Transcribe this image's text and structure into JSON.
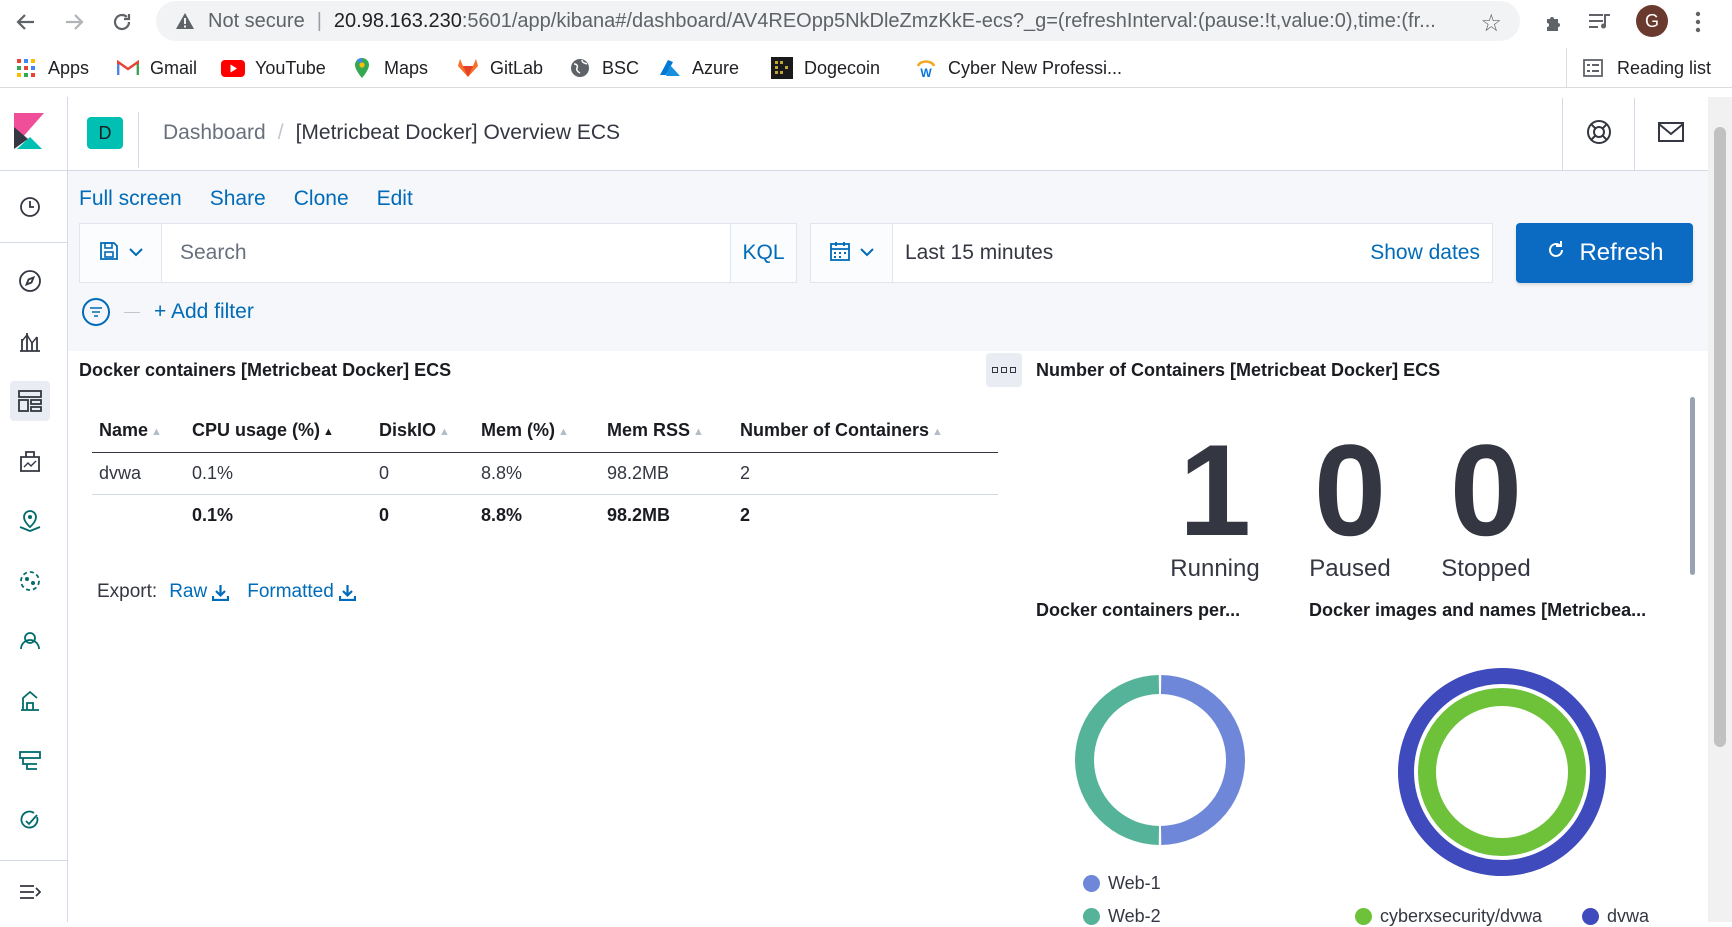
{
  "browser": {
    "security_label": "Not secure",
    "url_host": "20.98.163.230",
    "url_rest": ":5601/app/kibana#/dashboard/AV4REOpp5NkDleZmzKkE-ecs?_g=(refreshInterval:(pause:!t,value:0),time:(fr...",
    "avatar_initial": "G",
    "bookmarks": [
      {
        "label": "Apps",
        "icon": "apps-grid-icon"
      },
      {
        "label": "Gmail",
        "icon": "gmail-icon"
      },
      {
        "label": "YouTube",
        "icon": "youtube-icon"
      },
      {
        "label": "Maps",
        "icon": "maps-icon"
      },
      {
        "label": "GitLab",
        "icon": "gitlab-icon"
      },
      {
        "label": "BSC",
        "icon": "globe-icon"
      },
      {
        "label": "Azure",
        "icon": "azure-icon"
      },
      {
        "label": "Dogecoin",
        "icon": "dogecoin-icon"
      },
      {
        "label": "Cyber New Professi...",
        "icon": "workday-icon"
      }
    ],
    "reading_list": "Reading list"
  },
  "kibana": {
    "space_initial": "D",
    "breadcrumb": {
      "parent": "Dashboard",
      "current": "[Metricbeat Docker] Overview ECS"
    },
    "top_links": [
      "Full screen",
      "Share",
      "Clone",
      "Edit"
    ],
    "search": {
      "placeholder": "Search",
      "language": "KQL"
    },
    "time": {
      "range": "Last 15 minutes",
      "show_dates": "Show dates"
    },
    "refresh_label": "Refresh",
    "add_filter": "+ Add filter"
  },
  "containers_panel": {
    "title": "Docker containers [Metricbeat Docker] ECS",
    "columns": [
      "Name",
      "CPU usage (%)",
      "DiskIO",
      "Mem (%)",
      "Mem RSS",
      "Number of Containers"
    ],
    "rows": [
      [
        "dvwa",
        "0.1%",
        "0",
        "8.8%",
        "98.2MB",
        "2"
      ]
    ],
    "totals": [
      "",
      "0.1%",
      "0",
      "8.8%",
      "98.2MB",
      "2"
    ],
    "export_label": "Export:",
    "export_raw": "Raw",
    "export_formatted": "Formatted"
  },
  "count_panel": {
    "title": "Number of Containers [Metricbeat Docker] ECS",
    "metrics": [
      {
        "value": "1",
        "label": "Running"
      },
      {
        "value": "0",
        "label": "Paused"
      },
      {
        "value": "0",
        "label": "Stopped"
      }
    ]
  },
  "host_panel": {
    "title": "Docker containers per...",
    "slices": [
      {
        "label": "Web-1",
        "color": "#6f87d8",
        "fraction": 0.5
      },
      {
        "label": "Web-2",
        "color": "#54b399",
        "fraction": 0.5
      }
    ]
  },
  "images_panel": {
    "title": "Docker images and names [Metricbea...",
    "rings": [
      {
        "label": "cyberxsecurity/dvwa",
        "color": "#6dc23a"
      },
      {
        "label": "dvwa",
        "color": "#3f4bbd"
      }
    ]
  }
}
